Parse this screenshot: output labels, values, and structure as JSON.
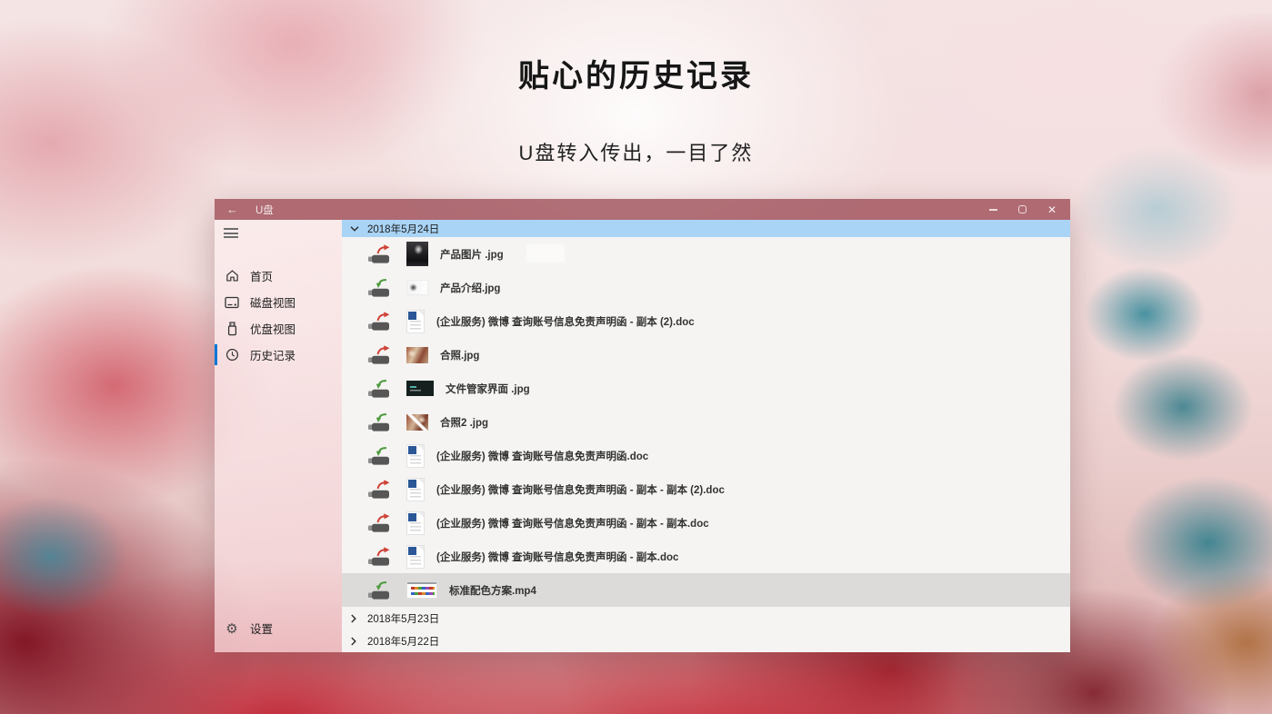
{
  "page": {
    "title": "贴心的历史记录",
    "subtitle": "U盘转入传出，一目了然"
  },
  "window": {
    "titlebar": {
      "back_glyph": "←",
      "title": "U盘",
      "close_glyph": "✕"
    },
    "sidebar": {
      "items": [
        {
          "label": "首页",
          "icon": "home-icon",
          "selected": false
        },
        {
          "label": "磁盘视图",
          "icon": "disk-view-icon",
          "selected": false
        },
        {
          "label": "优盘视图",
          "icon": "usb-drive-icon",
          "selected": false
        },
        {
          "label": "历史记录",
          "icon": "clock-icon",
          "selected": true
        }
      ],
      "bottom_item": {
        "label": "设置",
        "icon": "gear-icon",
        "gear_glyph": "⚙"
      }
    },
    "history": {
      "groups": [
        {
          "date": "2018年5月24日",
          "expanded": true,
          "files": [
            {
              "name": "产品图片 .jpg",
              "direction": "out",
              "thumb": "album",
              "redacted": true,
              "selected": false
            },
            {
              "name": "产品介绍.jpg",
              "direction": "in",
              "thumb": "logo",
              "selected": false
            },
            {
              "name": "(企业服务) 微博 查询账号信息免责声明函 - 副本 (2).doc",
              "direction": "out",
              "thumb": "doc",
              "selected": false
            },
            {
              "name": "合照.jpg",
              "direction": "out",
              "thumb": "photo",
              "selected": false
            },
            {
              "name": "文件管家界面 .jpg",
              "direction": "in",
              "thumb": "darkui",
              "selected": false
            },
            {
              "name": "合照2 .jpg",
              "direction": "in",
              "thumb": "photo2",
              "selected": false
            },
            {
              "name": "(企业服务) 微博 查询账号信息免责声明函.doc",
              "direction": "in",
              "thumb": "doc",
              "selected": false
            },
            {
              "name": "(企业服务) 微博 查询账号信息免责声明函 - 副本 - 副本 (2).doc",
              "direction": "out",
              "thumb": "doc",
              "selected": false
            },
            {
              "name": "(企业服务) 微博 查询账号信息免责声明函 - 副本 - 副本.doc",
              "direction": "out",
              "thumb": "doc",
              "selected": false
            },
            {
              "name": "(企业服务) 微博 查询账号信息免责声明函 - 副本.doc",
              "direction": "out",
              "thumb": "doc",
              "selected": false
            },
            {
              "name": "标准配色方案.mp4",
              "direction": "in",
              "thumb": "palette",
              "selected": true
            }
          ]
        },
        {
          "date": "2018年5月23日",
          "expanded": false
        },
        {
          "date": "2018年5月22日",
          "expanded": false
        }
      ]
    }
  },
  "colors": {
    "accent_blue": "#0078d7",
    "group_header_blue": "#a9d4f6",
    "transfer_out_red": "#cf4136",
    "transfer_in_green": "#4d9a3e",
    "selected_row_gray": "#dcdbd9"
  }
}
